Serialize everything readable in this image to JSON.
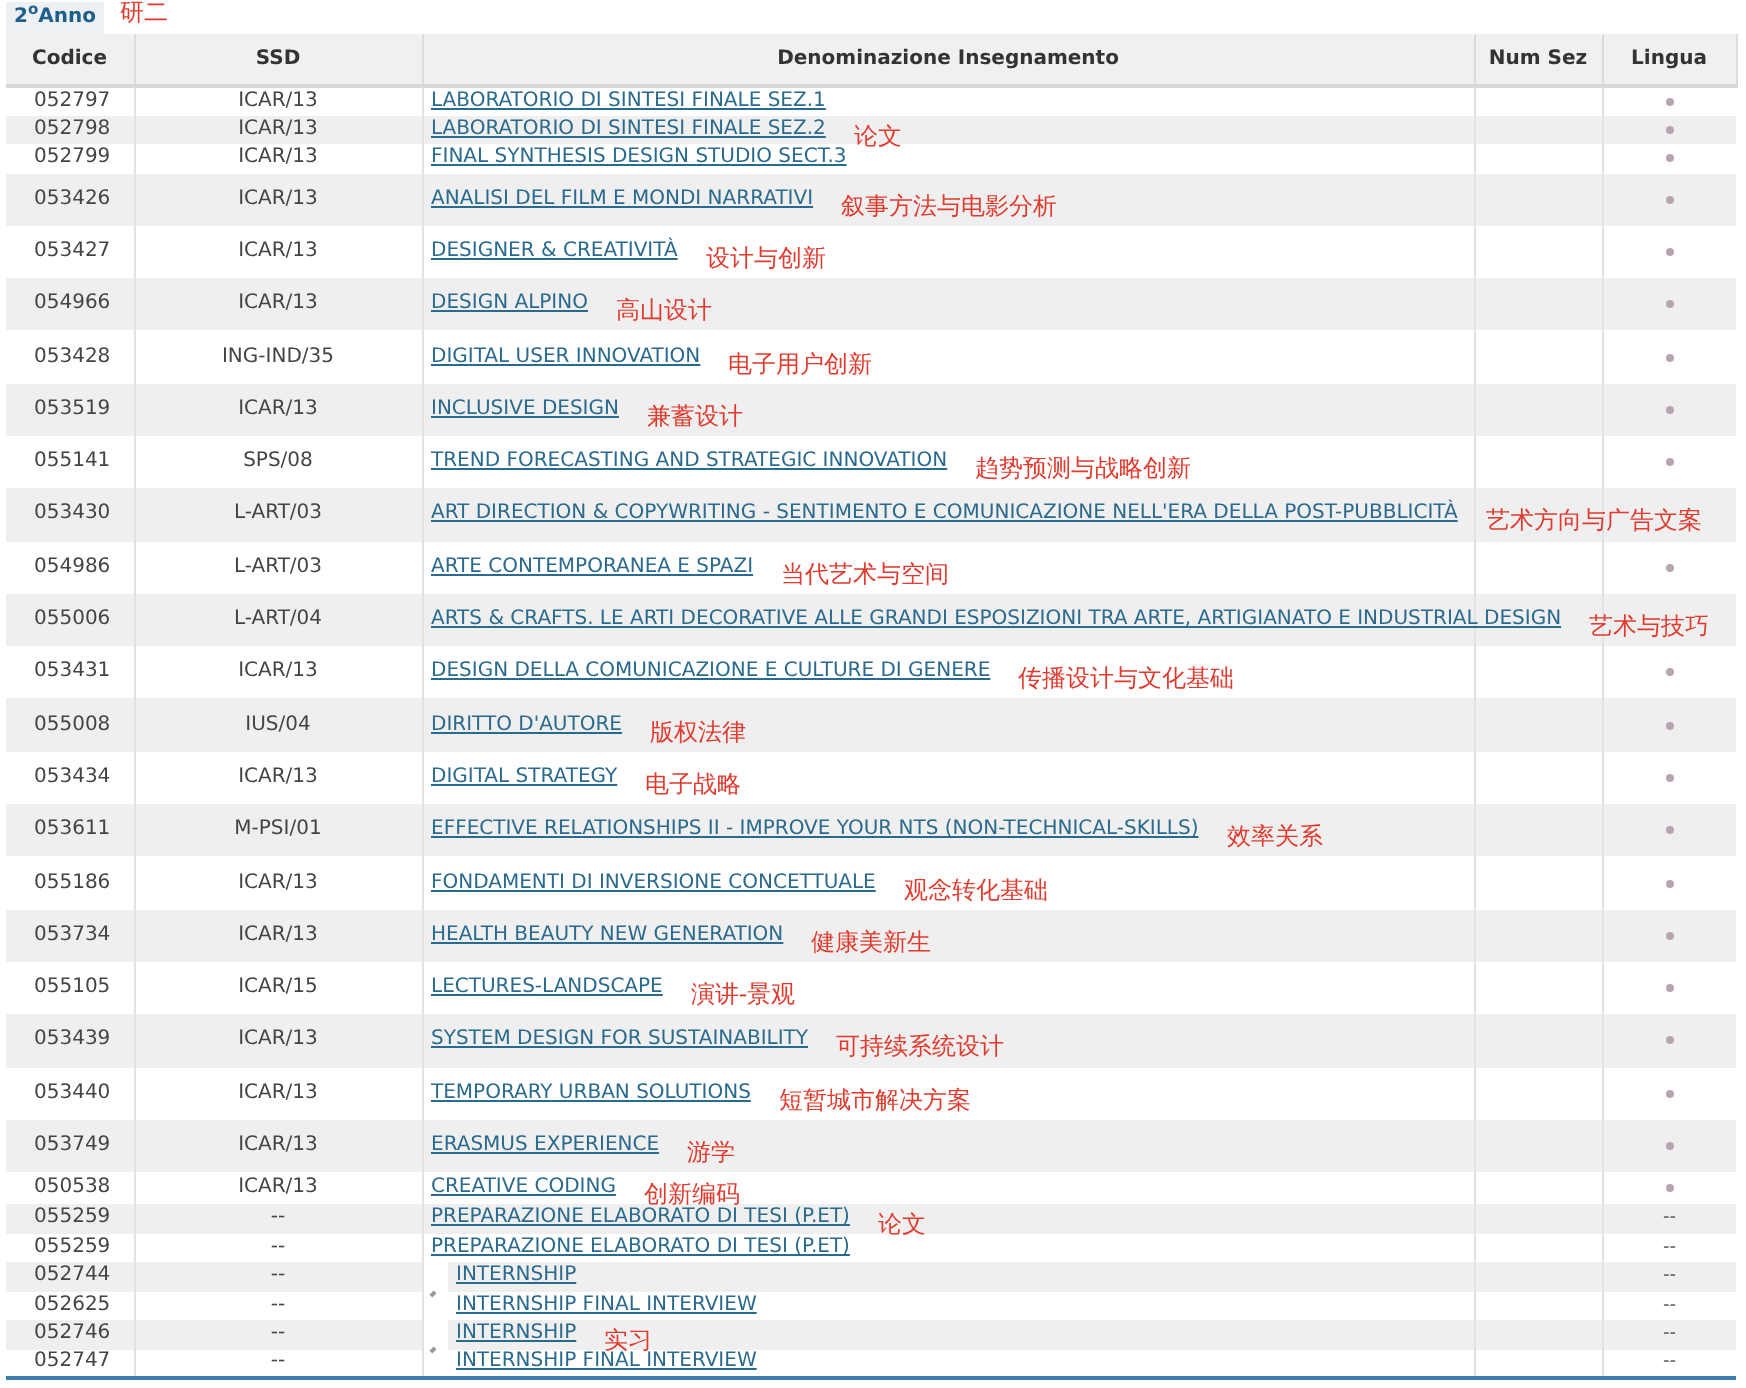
{
  "year_tab": {
    "label": "2$^{o}$Anno",
    "note": "研二"
  },
  "columns": [
    "Codice",
    "SSD",
    "Denominazione Insegnamento",
    "Num Sez",
    "Lingua"
  ],
  "rows": [
    {
      "kind": "compact",
      "code": "052797",
      "ssd": "ICAR/13",
      "title": "LABORATORIO DI SINTESI FINALE SEZ.1",
      "flag": true
    },
    {
      "kind": "compact",
      "code": "052798",
      "ssd": "ICAR/13",
      "title": "LABORATORIO DI SINTESI FINALE SEZ.2",
      "note": "论文",
      "flag": true
    },
    {
      "kind": "compact",
      "code": "052799",
      "ssd": "ICAR/13",
      "title": "FINAL SYNTHESIS DESIGN STUDIO SECT.3",
      "flag": true
    },
    {
      "kind": "tall",
      "code": "053426",
      "ssd": "ICAR/13",
      "title": "ANALISI DEL FILM E MONDI NARRATIVI",
      "note": "叙事方法与电影分析",
      "flag": true
    },
    {
      "kind": "tall",
      "code": "053427",
      "ssd": "ICAR/13",
      "title": "DESIGNER & CREATIVITÀ",
      "note": "设计与创新",
      "flag": true
    },
    {
      "kind": "tall",
      "code": "054966",
      "ssd": "ICAR/13",
      "title": "DESIGN ALPINO",
      "note": "高山设计",
      "flag": true
    },
    {
      "kind": "tall",
      "code": "053428",
      "ssd": "ING-IND/35",
      "title": "DIGITAL USER INNOVATION",
      "note": "电子用户创新",
      "flag": true
    },
    {
      "kind": "tall",
      "code": "053519",
      "ssd": "ICAR/13",
      "title": "INCLUSIVE DESIGN",
      "note": "兼蓄设计",
      "flag": true
    },
    {
      "kind": "tall",
      "code": "055141",
      "ssd": "SPS/08",
      "title": "TREND FORECASTING AND STRATEGIC INNOVATION",
      "note": "趋势预测与战略创新",
      "flag": true
    },
    {
      "kind": "tall",
      "code": "053430",
      "ssd": "L-ART/03",
      "title": "ART DIRECTION & COPYWRITING - SENTIMENTO E COMUNICAZIONE NELL'ERA DELLA POST-PUBBLICITÀ",
      "note": "艺术方向与广告文案",
      "flag": false
    },
    {
      "kind": "tall",
      "code": "054986",
      "ssd": "L-ART/03",
      "title": "ARTE CONTEMPORANEA E SPAZI",
      "note": "当代艺术与空间",
      "flag": true
    },
    {
      "kind": "tall",
      "code": "055006",
      "ssd": "L-ART/04",
      "title": "ARTS & CRAFTS. LE ARTI DECORATIVE ALLE GRANDI ESPOSIZIONI TRA ARTE, ARTIGIANATO E INDUSTRIAL DESIGN",
      "note": "艺术与技巧",
      "flag": false
    },
    {
      "kind": "tall",
      "code": "053431",
      "ssd": "ICAR/13",
      "title": "DESIGN DELLA COMUNICAZIONE E CULTURE DI GENERE",
      "note": "传播设计与文化基础",
      "flag": true
    },
    {
      "kind": "tall",
      "code": "055008",
      "ssd": "IUS/04",
      "title": "DIRITTO D'AUTORE",
      "note": "版权法律",
      "flag": true
    },
    {
      "kind": "tall",
      "code": "053434",
      "ssd": "ICAR/13",
      "title": "DIGITAL STRATEGY",
      "note": "电子战略",
      "flag": true
    },
    {
      "kind": "tall",
      "code": "053611",
      "ssd": "M-PSI/01",
      "title": "EFFECTIVE RELATIONSHIPS II - IMPROVE YOUR NTS (NON-TECHNICAL-SKILLS)",
      "note": "效率关系",
      "flag": true
    },
    {
      "kind": "tall",
      "code": "055186",
      "ssd": "ICAR/13",
      "title": "FONDAMENTI DI INVERSIONE CONCETTUALE",
      "note": "观念转化基础",
      "flag": true
    },
    {
      "kind": "tall",
      "code": "053734",
      "ssd": "ICAR/13",
      "title": "HEALTH  BEAUTY NEW GENERATION",
      "note": "健康美新生",
      "flag": true
    },
    {
      "kind": "tall",
      "code": "055105",
      "ssd": "ICAR/15",
      "title": "LECTURES-LANDSCAPE",
      "note": "演讲-景观",
      "flag": true
    },
    {
      "kind": "tall",
      "code": "053439",
      "ssd": "ICAR/13",
      "title": "SYSTEM DESIGN FOR SUSTAINABILITY",
      "note": "可持续系统设计",
      "flag": true
    },
    {
      "kind": "tall",
      "code": "053440",
      "ssd": "ICAR/13",
      "title": "TEMPORARY URBAN SOLUTIONS",
      "note": "短暂城市解决方案",
      "flag": true
    },
    {
      "kind": "tall",
      "code": "053749",
      "ssd": "ICAR/13",
      "title": "ERASMUS EXPERIENCE",
      "note": "游学",
      "flag": true
    },
    {
      "kind": "medium",
      "code": "050538",
      "ssd": "ICAR/13",
      "title": "CREATIVE CODING",
      "note": "创新编码",
      "flag": true
    },
    {
      "kind": "compact",
      "code": "055259",
      "ssd": "--",
      "title": "PREPARAZIONE ELABORATO DI TESI (P.ET)",
      "note": "论文",
      "lingua": "--"
    },
    {
      "kind": "compact",
      "code": "055259",
      "ssd": "--",
      "title": "PREPARAZIONE ELABORATO DI TESI (P.ET)",
      "lingua": "--"
    },
    {
      "kind": "pair",
      "rows": [
        {
          "code": "052744",
          "ssd": "--",
          "title": "INTERNSHIP",
          "lingua": "--"
        },
        {
          "code": "052625",
          "ssd": "--",
          "title": "INTERNSHIP FINAL INTERVIEW",
          "lingua": "--"
        }
      ]
    },
    {
      "kind": "pair",
      "rows": [
        {
          "code": "052746",
          "ssd": "--",
          "title": "INTERNSHIP",
          "note": "实习",
          "lingua": "--"
        },
        {
          "code": "052747",
          "ssd": "--",
          "title": "INTERNSHIP FINAL INTERVIEW",
          "lingua": "--"
        }
      ]
    }
  ]
}
